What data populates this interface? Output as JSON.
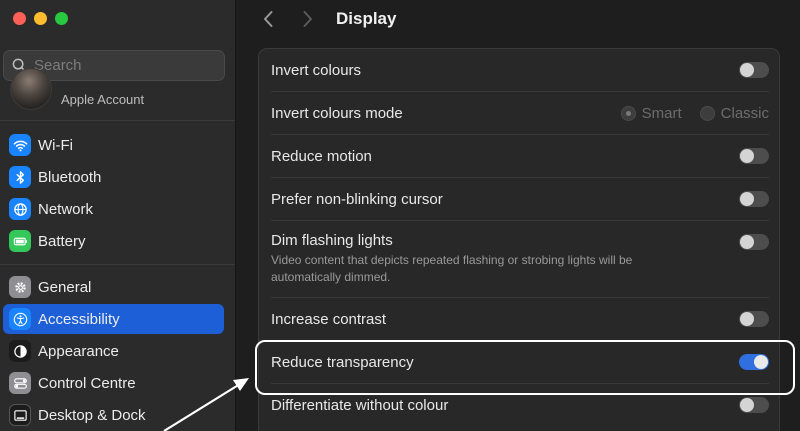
{
  "sidebar": {
    "search": {
      "placeholder": "Search"
    },
    "account": {
      "label": "Apple Account"
    },
    "items": [
      {
        "label": "Wi-Fi",
        "icon": "wifi-icon",
        "color": "#1a84ff"
      },
      {
        "label": "Bluetooth",
        "icon": "bluetooth-icon",
        "color": "#1a84ff"
      },
      {
        "label": "Network",
        "icon": "globe-icon",
        "color": "#1a84ff"
      },
      {
        "label": "Battery",
        "icon": "battery-icon",
        "color": "#34c759"
      },
      {
        "label": "General",
        "icon": "gear-icon",
        "color": "#8e8e93"
      },
      {
        "label": "Accessibility",
        "icon": "accessibility-icon",
        "color": "#1a84ff",
        "selected": true
      },
      {
        "label": "Appearance",
        "icon": "appearance-icon",
        "color": "#1c1c1c"
      },
      {
        "label": "Control Centre",
        "icon": "control-centre-icon",
        "color": "#8e8e93"
      },
      {
        "label": "Desktop & Dock",
        "icon": "desktop-dock-icon",
        "color": "#1c1c1c"
      }
    ]
  },
  "main": {
    "title": "Display",
    "rows": [
      {
        "label": "Invert colours",
        "type": "toggle",
        "on": false
      },
      {
        "label": "Invert colours mode",
        "type": "radio",
        "options": [
          "Smart",
          "Classic"
        ],
        "selected": "Smart",
        "disabled": true
      },
      {
        "label": "Reduce motion",
        "type": "toggle",
        "on": false
      },
      {
        "label": "Prefer non-blinking cursor",
        "type": "toggle",
        "on": false
      },
      {
        "label": "Dim flashing lights",
        "type": "toggle",
        "on": false,
        "description": "Video content that depicts repeated flashing or strobing lights will be automatically dimmed."
      },
      {
        "label": "Increase contrast",
        "type": "toggle",
        "on": false
      },
      {
        "label": "Reduce transparency",
        "type": "toggle",
        "on": true,
        "highlighted": true
      },
      {
        "label": "Differentiate without colour",
        "type": "toggle",
        "on": false
      }
    ]
  },
  "colors": {
    "accent": "#2f6fe0",
    "selection": "#1d5fd6",
    "annotation": "#ffffff"
  }
}
